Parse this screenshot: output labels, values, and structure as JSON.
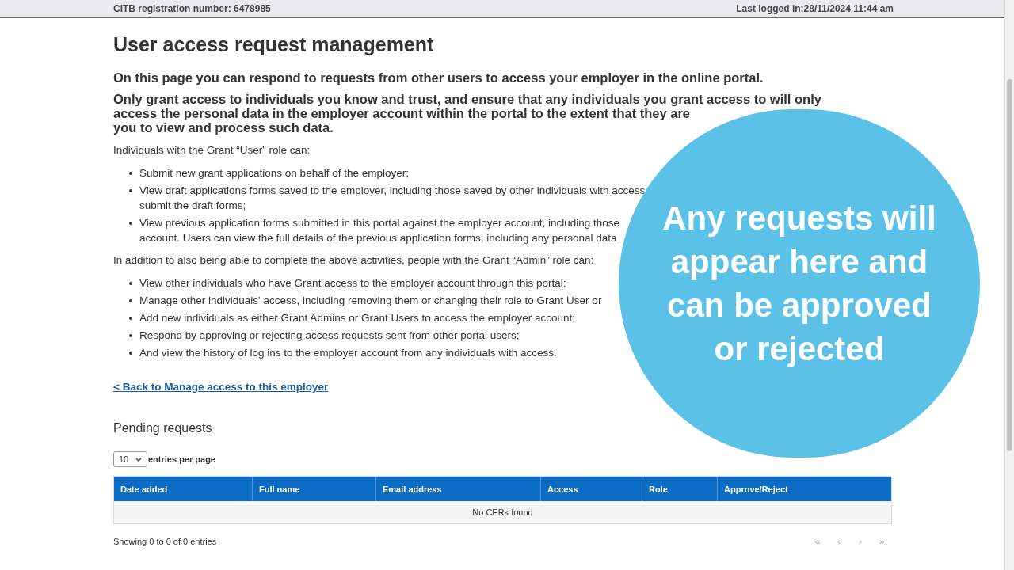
{
  "header": {
    "registration": "CITB registration number: 6478985",
    "last_logged": "Last logged in:28/11/2024 11:44 am"
  },
  "title": "User access request management",
  "intro": "On this page you can respond to requests from other users to access your employer in the online portal.",
  "warning_lines": [
    "Only grant access to individuals you know and trust, and ensure that any individuals you grant access to will only",
    "access the personal data in the employer account within the portal to the extent that they are",
    "you to view and process such data."
  ],
  "user_heading": "Individuals with the Grant “User” role can:",
  "user_bullets": [
    [
      "Submit new grant applications on behalf of the employer;"
    ],
    [
      "View draft applications forms saved to the employer, including those saved by other individuals with access",
      "submit the draft forms;"
    ],
    [
      "View previous application forms submitted in this portal against the employer account, including those",
      "account. Users can view the full details of the previous application forms, including any personal data"
    ]
  ],
  "admin_heading": "In addition to also being able to complete the above activities, people with the Grant “Admin” role can:",
  "admin_bullets": [
    [
      "View other individuals who have Grant access to the employer account through this portal;"
    ],
    [
      "Manage other individuals' access, including removing them or changing their role to Grant User or"
    ],
    [
      "Add new individuals as either Grant Admins or Grant Users to access the employer account;"
    ],
    [
      "Respond by approving or rejecting access requests sent from other portal users;"
    ],
    [
      "And view the history of log ins to the employer account from any individuals with access."
    ]
  ],
  "back_link": "< Back to Manage access to this employer",
  "pending": {
    "title": "Pending requests",
    "page_size": "10",
    "page_size_label": "entries per page",
    "columns": [
      "Date added",
      "Full name",
      "Email address",
      "Access",
      "Role",
      "Approve/Reject"
    ],
    "empty": "No CERs found",
    "summary": "Showing 0 to 0 of 0 entries",
    "pager": [
      "«",
      "‹",
      "›",
      "»"
    ]
  },
  "overlay": {
    "lines": [
      "Any requests will",
      "appear here and",
      "can be approved",
      "or rejected"
    ]
  }
}
